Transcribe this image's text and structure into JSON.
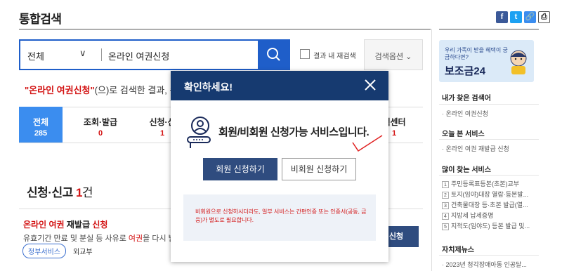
{
  "header": {
    "title": "통합검색",
    "share_labels": [
      "f",
      "t",
      "🔗",
      "⎙"
    ]
  },
  "search": {
    "scope": "전체",
    "query": "온라인 여권신청",
    "within_label": "결과 내 재검색",
    "options_label": "검색옵션"
  },
  "result": {
    "query_quoted": "\"온라인 여권신청\"",
    "suffix": "(으)로 검색한 결과, 총 2"
  },
  "tabs": [
    {
      "label": "전체",
      "count": "285"
    },
    {
      "label": "조회·발급",
      "count": "0"
    },
    {
      "label": "신청·신",
      "count": "1"
    },
    {
      "label": "백센터",
      "count": "1"
    }
  ],
  "section": {
    "title": "신청·신고 ",
    "count": "1",
    "count_suffix": "건"
  },
  "item": {
    "title_hl": "온라인 여권",
    "title_rest": " 재발급 ",
    "title_hl2": "신청",
    "desc_a": "유효기간 만료 및 분실 등 사유로 ",
    "desc_hl": "여권",
    "desc_b": "을 다시 발급받",
    "tag": "정부서비스",
    "org": "외교부",
    "apply": "신청"
  },
  "sidebar": {
    "banner_sub": "우리 가족이 받을 혜택이 궁금하다면?",
    "banner_main": "보조금24",
    "recent_h": "내가 찾은 검색어",
    "recent_items": [
      "· 온라인 여권신청"
    ],
    "today_h": "오늘 본 서비스",
    "today_items": [
      "· 온라인 여권 재발급 신청"
    ],
    "popular_h": "많이 찾는 서비스",
    "popular_items": [
      "주민등록표등본(초본)교부",
      "토지(임야)대장 열람·등본발...",
      "건축물대장 등·초본 발급(열...",
      "지방세 납세증명",
      "지적도(임야도) 등본 발급 및..."
    ],
    "news_h": "자치제뉴스",
    "news_items": [
      "· 2023년 청각장애아동 인공달..."
    ]
  },
  "modal": {
    "title": "확인하세요!",
    "message": "회원/비회원 신청가능 서비스입니다.",
    "member_btn": "회원 신청하기",
    "nonmember_btn": "비회원 신청하기",
    "notice": "비회원으로 신청하시더라도, 일부 서비스는 간편인증 또는 인증서(공동, 금융)가 별도로 필요합니다."
  },
  "colors": {
    "accent": "#1f5ec9",
    "modal_header": "#163a70",
    "highlight": "#d31313"
  }
}
